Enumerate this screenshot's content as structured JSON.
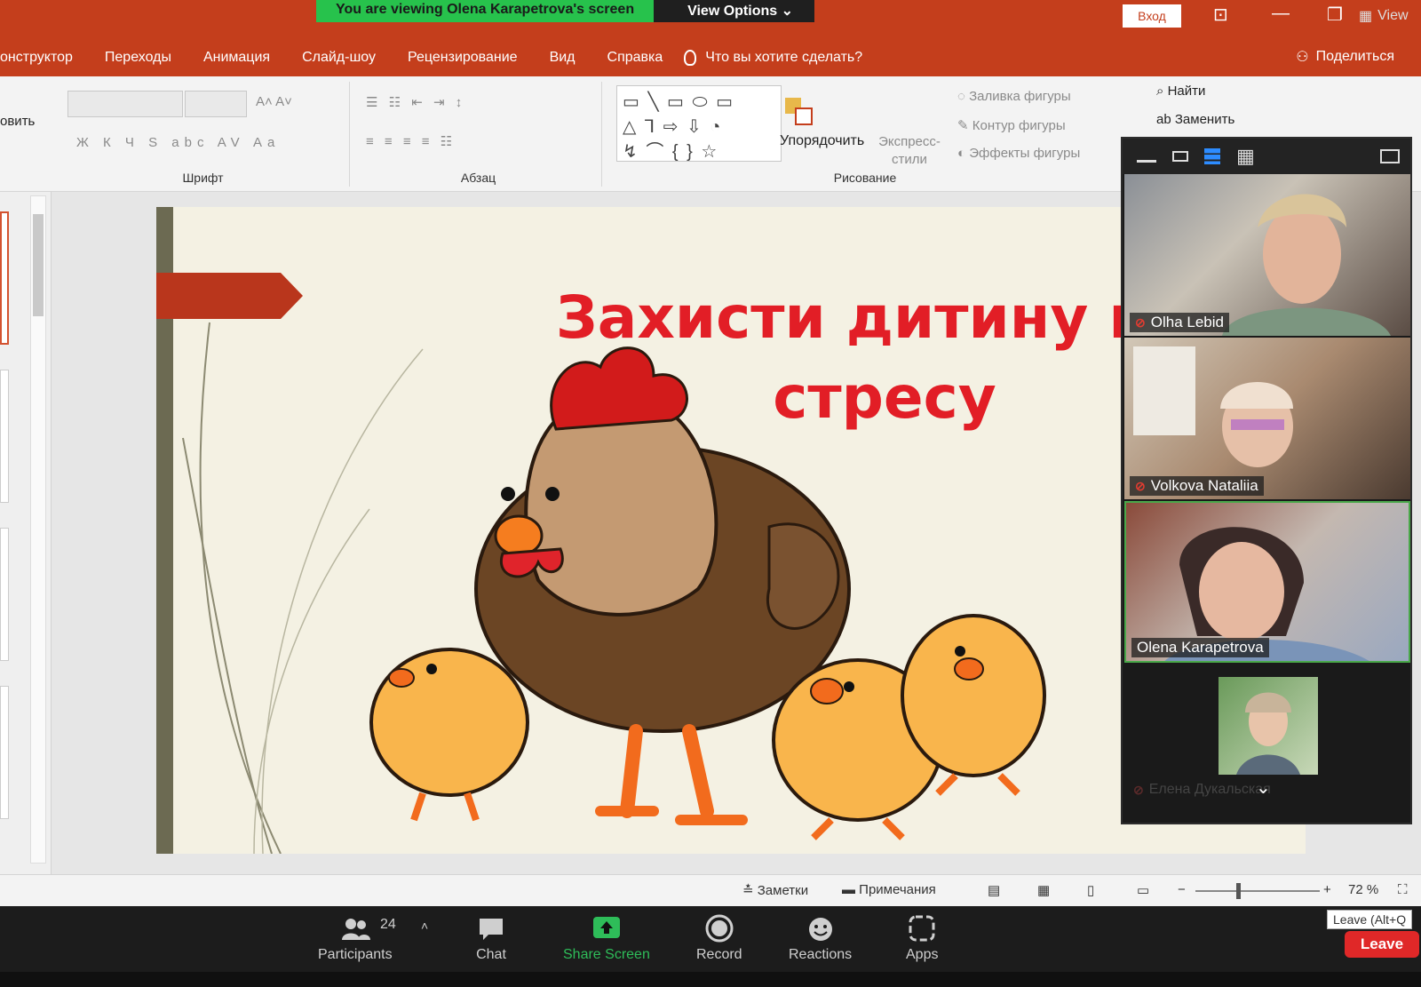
{
  "zoom": {
    "share_banner": "You are viewing Olena Karapetrova's screen",
    "view_options_label": "View Options",
    "view_label": "View",
    "participants_count": "24",
    "toolbar": {
      "participants": "Participants",
      "chat": "Chat",
      "share_screen": "Share Screen",
      "record": "Record",
      "reactions": "Reactions",
      "apps": "Apps"
    },
    "leave_label": "Leave",
    "leave_tooltip": "Leave (Alt+Q",
    "participants_tiles": [
      {
        "name": "Olha Lebid",
        "muted": true
      },
      {
        "name": "Volkova Nataliia",
        "muted": true
      },
      {
        "name": "Olena Karapetrova",
        "muted": false
      },
      {
        "name": "Елена Дукальская",
        "muted": true
      }
    ]
  },
  "ppt": {
    "sign_in": "Вход",
    "tabs": [
      "онструктор",
      "Переходы",
      "Анимация",
      "Слайд-шоу",
      "Рецензирование",
      "Вид",
      "Справка"
    ],
    "tell_me": "Что вы хотите сделать?",
    "share": "Поделиться",
    "ribbon": {
      "font_group": "Шрифт",
      "paragraph_group": "Абзац",
      "drawing_group": "Рисование",
      "arrange": "Упорядочить",
      "quick_styles": "Экспресс-стили",
      "shape_fill": "Заливка фигуры",
      "shape_outline": "Контур фигуры",
      "shape_effects": "Эффекты фигуры",
      "find": "Найти",
      "replace": "Заменить",
      "restore_fragment": "овить"
    },
    "slide": {
      "title": "Захисти дитину від стресу"
    },
    "status": {
      "notes": "Заметки",
      "comments": "Примечания",
      "zoom_level": "72 %"
    }
  },
  "colors": {
    "ppt_accent": "#c43e1c",
    "zoom_green": "#27c24c",
    "leave_red": "#e02828",
    "slide_title": "#e21e26"
  }
}
